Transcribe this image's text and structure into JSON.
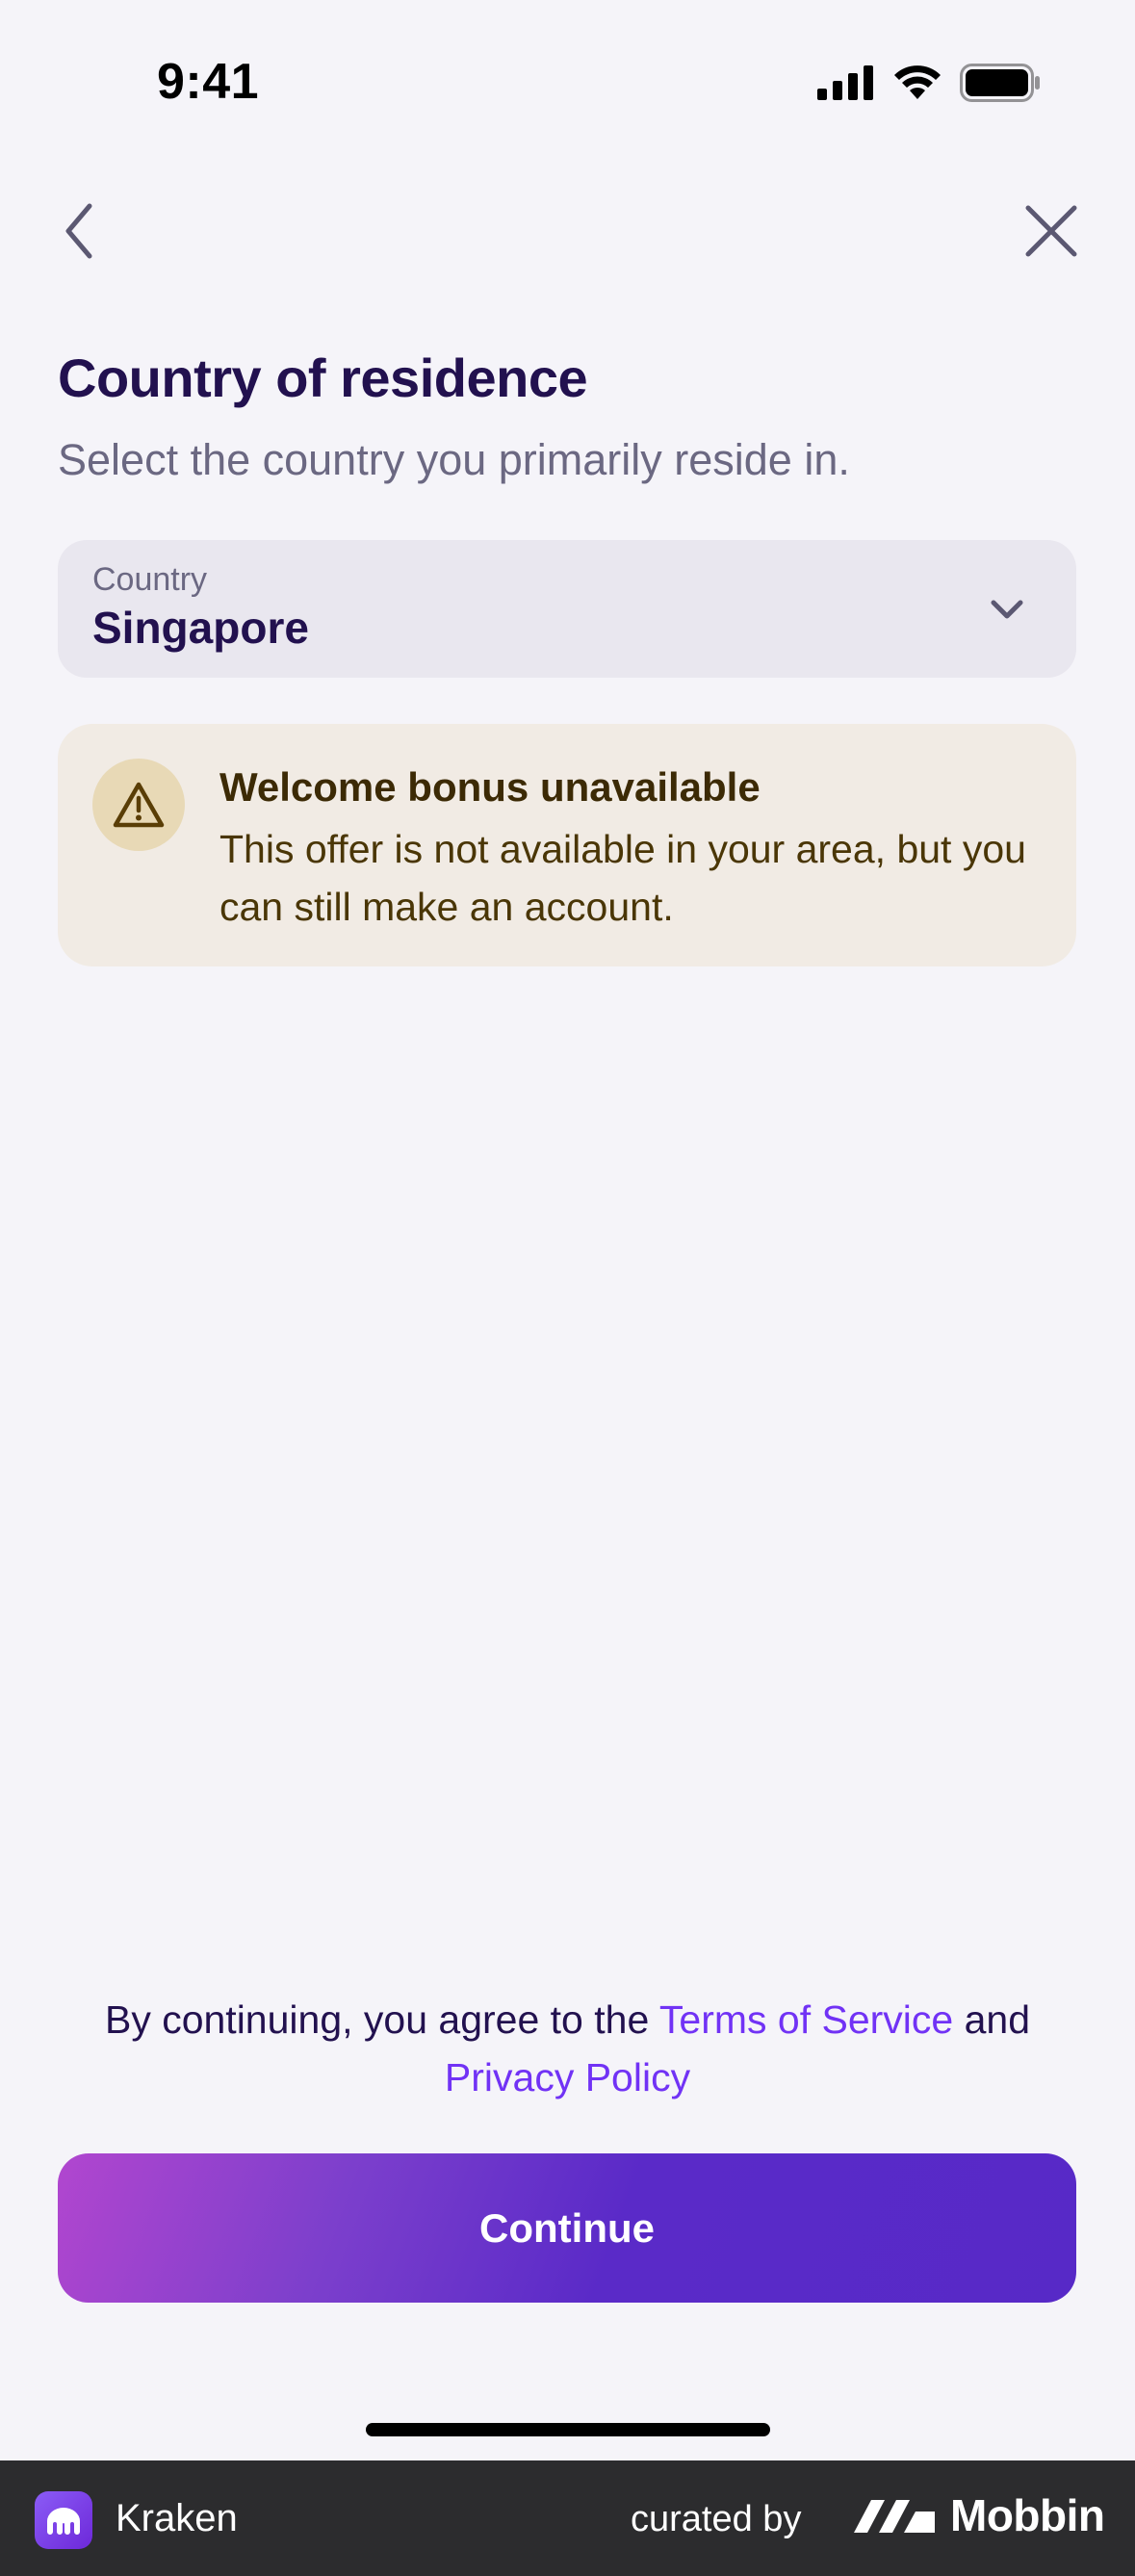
{
  "status_bar": {
    "time": "9:41",
    "icons": [
      "cellular-signal-icon",
      "wifi-icon",
      "battery-icon"
    ]
  },
  "nav": {
    "back_icon": "chevron-left-icon",
    "close_icon": "close-icon"
  },
  "page": {
    "title": "Country of residence",
    "subtitle": "Select the country you primarily reside in."
  },
  "country_select": {
    "label": "Country",
    "value": "Singapore",
    "icon": "chevron-down-icon"
  },
  "alert": {
    "icon": "warning-triangle-icon",
    "title": "Welcome bonus unavailable",
    "body": "This offer is not available in your area, but you can still make an account."
  },
  "legal": {
    "prefix": "By continuing, you agree to the ",
    "terms_link": "Terms of Service",
    "connector": " and",
    "privacy_link": "Privacy Policy"
  },
  "actions": {
    "continue_label": "Continue"
  },
  "branding": {
    "app_name": "Kraken",
    "curated_by": "curated by",
    "brand_name": "Mobbin"
  },
  "colors": {
    "background": "#f5f4f9",
    "title": "#22114f",
    "link": "#7132f5",
    "alert_bg": "#f1ebe4",
    "button_gradient_start": "#b146cf",
    "button_gradient_end": "#5729c7"
  }
}
